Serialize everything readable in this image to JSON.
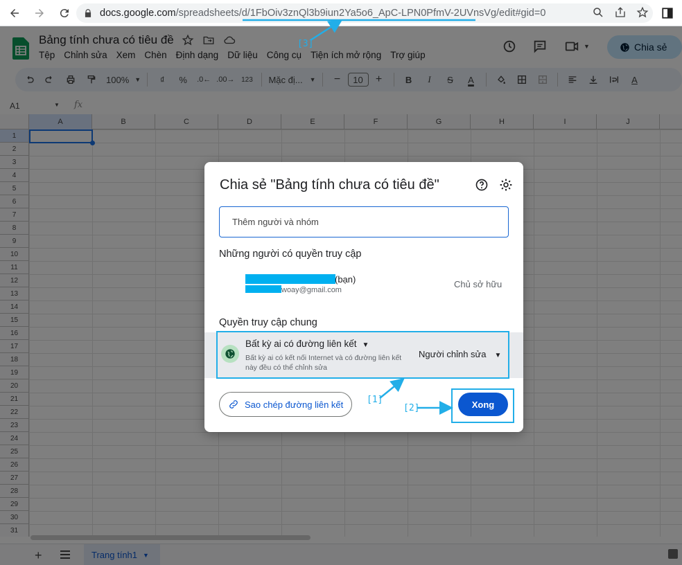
{
  "browser": {
    "url_host": "docs.google.com",
    "url_path": "/spreadsheets/d/",
    "url_id": "1FbOiv3znQl3b9iun2Ya5o6_ApC-LPN0PfmV-2UVnsVg",
    "url_tail": "/edit#gid=0"
  },
  "sheets": {
    "doc_title": "Bảng tính chưa có tiêu đề",
    "menu": [
      "Tệp",
      "Chỉnh sửa",
      "Xem",
      "Chèn",
      "Định dạng",
      "Dữ liệu",
      "Công cụ",
      "Tiện ích mở rộng",
      "Trợ giúp"
    ],
    "share_label": "Chia sẻ"
  },
  "toolbar": {
    "zoom": "100%",
    "currency": "₫",
    "percent": "%",
    "format_123": "123",
    "font": "Mặc đị...",
    "font_size": "10"
  },
  "formula": {
    "cell_ref": "A1",
    "fx": "fx"
  },
  "grid": {
    "columns": [
      "A",
      "B",
      "C",
      "D",
      "E",
      "F",
      "G",
      "H",
      "I",
      "J"
    ],
    "rows": [
      "1",
      "2",
      "3",
      "4",
      "5",
      "6",
      "7",
      "8",
      "9",
      "10",
      "11",
      "12",
      "13",
      "14",
      "15",
      "16",
      "17",
      "18",
      "19",
      "20",
      "21",
      "22",
      "23",
      "24",
      "25",
      "26",
      "27",
      "28",
      "29",
      "30",
      "31"
    ]
  },
  "bottom": {
    "add_sheet": "+",
    "sheet_tab": "Trang tính1"
  },
  "dialog": {
    "title": "Chia sẻ \"Bảng tính chưa có tiêu đề\"",
    "add_people_placeholder": "Thêm người và nhóm",
    "people_section": "Những người có quyền truy cập",
    "person_you": "(bạn)",
    "person_email": "woay@gmail.com",
    "owner_label": "Chủ sở hữu",
    "general_section": "Quyền truy cập chung",
    "access_type": "Bất kỳ ai có đường liên kết",
    "access_desc": "Bất kỳ ai có kết nối Internet và có đường liên kết này đều có thể chỉnh sửa",
    "role": "Người chỉnh sửa",
    "copy_link": "Sao chép đường liên kết",
    "done": "Xong"
  },
  "annotations": {
    "label_1": "[1]",
    "label_2": "[2]",
    "label_3": "[3]",
    "color": "#22aee8"
  },
  "colors": {
    "accent": "#0b57d0",
    "share_bg": "#c2e7ff",
    "sheets_green": "#0f9d58",
    "annotation": "#22aee8"
  }
}
